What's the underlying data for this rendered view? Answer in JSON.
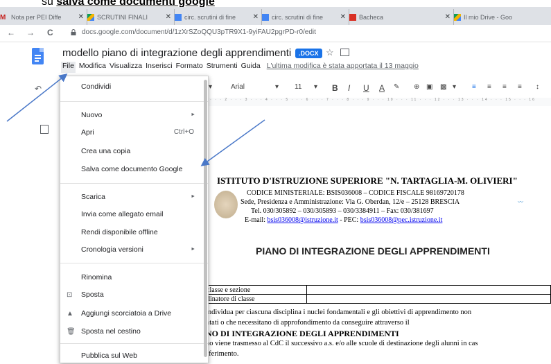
{
  "caption": {
    "prefix": "su ",
    "bold": "salva come documenti google"
  },
  "browser": {
    "tabs": [
      {
        "label": "Nota per PEI Diffe",
        "color": "#c5221f"
      },
      {
        "label": "SCRUTINI FINALI",
        "color": "#f4b400"
      },
      {
        "label": "circ. scrutini di fine",
        "color": "#4285f4"
      },
      {
        "label": "circ. scrutini di fine",
        "color": "#4285f4"
      },
      {
        "label": "Bacheca",
        "color": "#d93025"
      },
      {
        "label": "Il mio Drive - Goo",
        "color": "#0f9d58"
      }
    ],
    "url": "docs.google.com/document/d/1zXrSZoQQU3pTR9X1-9yiFAU2pgrPD-r0/edit",
    "nav": {
      "back": "←",
      "forward": "→",
      "reload": "C"
    }
  },
  "doc": {
    "title": "modello piano di integrazione degli apprendimenti",
    "badge": ".DOCX",
    "star": "☆",
    "menu": [
      "File",
      "Modifica",
      "Visualizza",
      "Inserisci",
      "Formato",
      "Strumenti",
      "Guida"
    ],
    "last_edit": "L'ultima modifica è stata apportata il 13 maggio"
  },
  "toolbar": {
    "font": "Arial",
    "size": "11",
    "bold": "B",
    "italic": "I",
    "underline": "U",
    "color": "A"
  },
  "ruler": "1 · · · 2 · · · 3 · · · 4 · · · 5 · · · 6 · · · 7 · · · 8 · · · 9 · · · 10 · · · 11 · · · 12 · · · 13 · · · 14 · · · 15 · · · 16",
  "file_menu": {
    "items": [
      {
        "label": "Condividi"
      },
      {
        "label": "Nuovo",
        "submenu": true
      },
      {
        "label": "Apri",
        "shortcut": "Ctrl+O"
      },
      {
        "label": "Crea una copia"
      },
      {
        "label": "Salva come documento Google"
      },
      {
        "label": "Scarica",
        "submenu": true
      },
      {
        "label": "Invia come allegato email"
      },
      {
        "label": "Rendi disponibile offline"
      },
      {
        "label": "Cronologia versioni",
        "submenu": true
      },
      {
        "label": "Rinomina"
      },
      {
        "label": "Sposta",
        "icon": "move-icon"
      },
      {
        "label": "Aggiungi scorciatoia a Drive",
        "icon": "drive-shortcut-icon"
      },
      {
        "label": "Sposta nel cestino",
        "icon": "trash-icon"
      },
      {
        "label": "Pubblica sul Web"
      }
    ]
  },
  "document": {
    "school": "ISTITUTO D'ISTRUZIONE SUPERIORE \"N. TARTAGLIA-M. OLIVIERI\"",
    "codes": "CODICE MINISTERIALE: BSIS036008 – CODICE FISCALE 98169720178",
    "address": "Sede, Presidenza e Amministrazione: Via G. Oberdan, 12/e – 25128 BRESCIA",
    "phone": "Tel. 030/305892 – 030/305893 – 030/3384911 – Fax: 030/381697",
    "email_prefix": "E-mail: ",
    "email": "bsis036008@istruzione.it",
    "pec_prefix": " - PEC: ",
    "pec": "bsis036008@pec.istruzione.it",
    "heading": "PIANO DI INTEGRAZIONE DEGLI APPRENDIMENTI",
    "table_rows": [
      "classe e sezione",
      "dinatore di classe"
    ],
    "body_lines": [
      "individua per ciascuna disciplina i nuclei fondamentali e gli obiettivi di apprendimento non",
      "ntati o che necessitano di approfondimento da conseguire attraverso il",
      "NO DI INTEGRAZIONE DEGLI APPRENDIMENTI",
      "no viene trasmesso al CdC  il successivo a.s. e/o  alle scuole di destinazione degli alunni in cas",
      "sferimento."
    ]
  }
}
